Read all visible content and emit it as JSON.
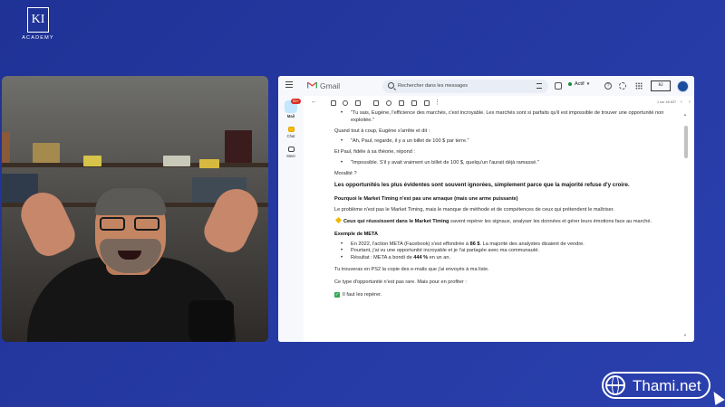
{
  "academy": {
    "brand": "ACADEMY",
    "mark": "KI"
  },
  "gmail": {
    "app_name": "Gmail",
    "search_placeholder": "Rechercher dans les messages",
    "status": "Actif",
    "pager": "1 sur 48 837",
    "rail": [
      {
        "label": "Mail",
        "badge": "99+",
        "active": true
      },
      {
        "label": "Chat",
        "active": false
      },
      {
        "label": "Meet",
        "active": false
      }
    ],
    "icons": [
      "hamburger-icon",
      "search-icon",
      "filter-icon",
      "status-icon",
      "help-icon",
      "settings-icon",
      "apps-icon"
    ]
  },
  "email": {
    "q1": "\"Tu sais, Eugène, l'efficience des marchés, c'est incroyable. Les marchés sont si parfaits qu'il est impossible de trouver une opportunité non exploitée.\"",
    "p1": "Quand tout à coup, Eugène s'arrête et dit :",
    "q2": "\"Ah, Paul, regarde, il y a un billet de 100 $ par terre.\"",
    "p2": "Et Paul, fidèle à sa théorie, répond :",
    "q3": "\"Impossible. S'il y avait vraiment un billet de 100 $, quelqu'un l'aurait déjà ramassé.\"",
    "moral_label": "Moralité ?",
    "moral": "Les opportunités les plus évidentes sont souvent ignorées, simplement parce que la majorité refuse d'y croire.",
    "h1": "Pourquoi le Market Timing n'est pas une arnaque (mais une arme puissante)",
    "p3": "Le problème n'est pas le Market Timing, mais le manque de méthode et de compétences de ceux qui prétendent le maîtriser.",
    "p4_bold": "Ceux qui réussissent dans le Market Timing",
    "p4_rest": " savent repérer les signaux, analyser les données et gérer leurs émotions face au marché.",
    "h2": "Exemple de META",
    "b1_pre": "En 2022, l'action META (Facebook) s'est effondrée à ",
    "b1_bold": "86 $",
    "b1_post": ". La majorité des analystes disaient de vendre.",
    "b2": "Pourtant, j'ai vu une opportunité incroyable et je l'ai partagée avec ma communauté.",
    "b3_pre": "Résultat : META a bondi de ",
    "b3_bold": "444 %",
    "b3_post": " en un an.",
    "p5": "Tu trouveras en PS2 la copie des e-mails que j'ai envoyés à ma liste.",
    "p6": "Ce type d'opportunité n'est pas rare. Mais pour en profiter :",
    "c1": "Il faut les repérer."
  },
  "watermark": {
    "text": "Thami.net"
  },
  "colors": {
    "background": "#22349a",
    "accent_green": "#34a853",
    "badge_red": "#d93025"
  }
}
